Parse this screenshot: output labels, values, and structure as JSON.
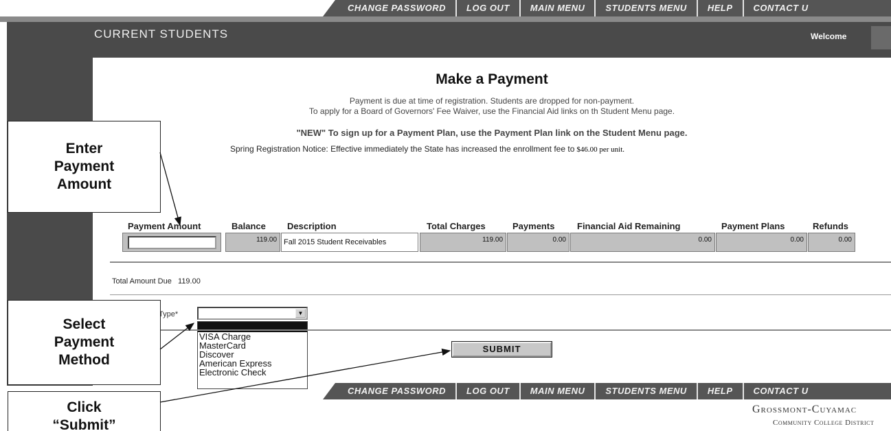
{
  "nav": {
    "items": [
      "Change Password",
      "Log Out",
      "Main Menu",
      "Students Menu",
      "Help",
      "Contact U"
    ]
  },
  "header": {
    "section_title": "Current Students",
    "welcome": "Welcome"
  },
  "page": {
    "title": "Make a Payment",
    "notice_line1": "Payment is due at time of registration. Students are dropped for non-payment.",
    "notice_line2": "To apply for a Board of Governors' Fee Waiver, use the Financial Aid links on th Student Menu page.",
    "notice_new": "\"NEW\" To sign up for a Payment Plan, use the Payment Plan link on the Student Menu page.",
    "notice_spring": "Spring Registration Notice: Effective immediately the State has increased the enrollment fee to",
    "fee_text": "$46.00 per unit."
  },
  "table": {
    "headers": [
      "Payment Amount",
      "Balance",
      "Description",
      "Total Charges",
      "Payments",
      "Financial Aid Remaining",
      "Payment Plans",
      "Refunds"
    ],
    "row": {
      "payment_amount": "",
      "balance": "119.00",
      "description": "Fall 2015 Student Receivables",
      "total_charges": "119.00",
      "payments": "0.00",
      "financial_aid_remaining": "0.00",
      "payment_plans": "0.00",
      "refunds": "0.00"
    }
  },
  "total": {
    "label": "Total Amount Due",
    "value": "119.00"
  },
  "payment_type": {
    "label": "Type*",
    "selected": "",
    "options": [
      "VISA Charge",
      "MasterCard",
      "Discover",
      "American Express",
      "Electronic Check"
    ]
  },
  "submit_label": "SUBMIT",
  "callouts": {
    "enter_amount": [
      "Enter",
      "Payment",
      "Amount"
    ],
    "select_method": [
      "Select",
      "Payment",
      "Method"
    ],
    "click_submit": [
      "Click",
      "“Submit”"
    ]
  },
  "footer": {
    "logo_line1": "Grossmont-Cuyamac",
    "logo_line2": "Community College District"
  }
}
